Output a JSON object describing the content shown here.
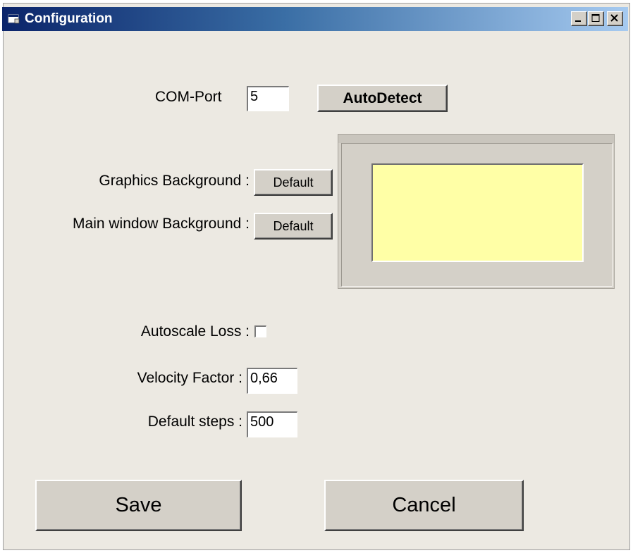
{
  "window": {
    "title": "Configuration",
    "icon": "app-window-icon",
    "controls": [
      "minimize-icon",
      "maximize-icon",
      "close-icon"
    ]
  },
  "com_port": {
    "label": "COM-Port",
    "value": "5",
    "autodetect_label": "AutoDetect"
  },
  "graphics_background": {
    "label": "Graphics Background :",
    "button_label": "Default"
  },
  "main_window_background": {
    "label": "Main window Background :",
    "button_label": "Default"
  },
  "preview": {
    "color": "#ffffa6"
  },
  "autoscale_loss": {
    "label": "Autoscale Loss :",
    "checked": false
  },
  "velocity_factor": {
    "label": "Velocity Factor :",
    "value": "0,66"
  },
  "default_steps": {
    "label": "Default steps :",
    "value": "500"
  },
  "actions": {
    "save_label": "Save",
    "cancel_label": "Cancel"
  },
  "colors": {
    "titlebar_start": "#0b246a",
    "titlebar_end": "#a6caf0",
    "window_bg": "#ece9e2",
    "button_face": "#d4d0c8"
  }
}
